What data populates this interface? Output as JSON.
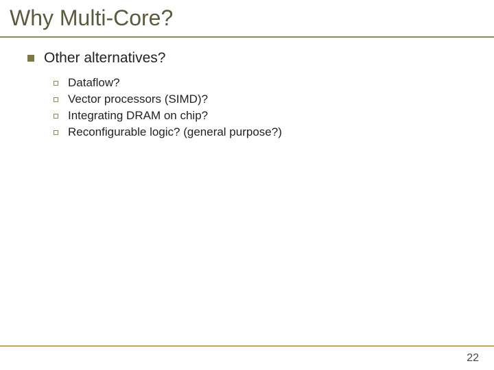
{
  "title": "Why Multi-Core?",
  "section": {
    "heading": "Other alternatives?",
    "items": [
      "Dataflow?",
      "Vector processors (SIMD)?",
      "Integrating DRAM on chip?",
      "Reconfigurable logic? (general purpose?)"
    ]
  },
  "page_number": "22"
}
